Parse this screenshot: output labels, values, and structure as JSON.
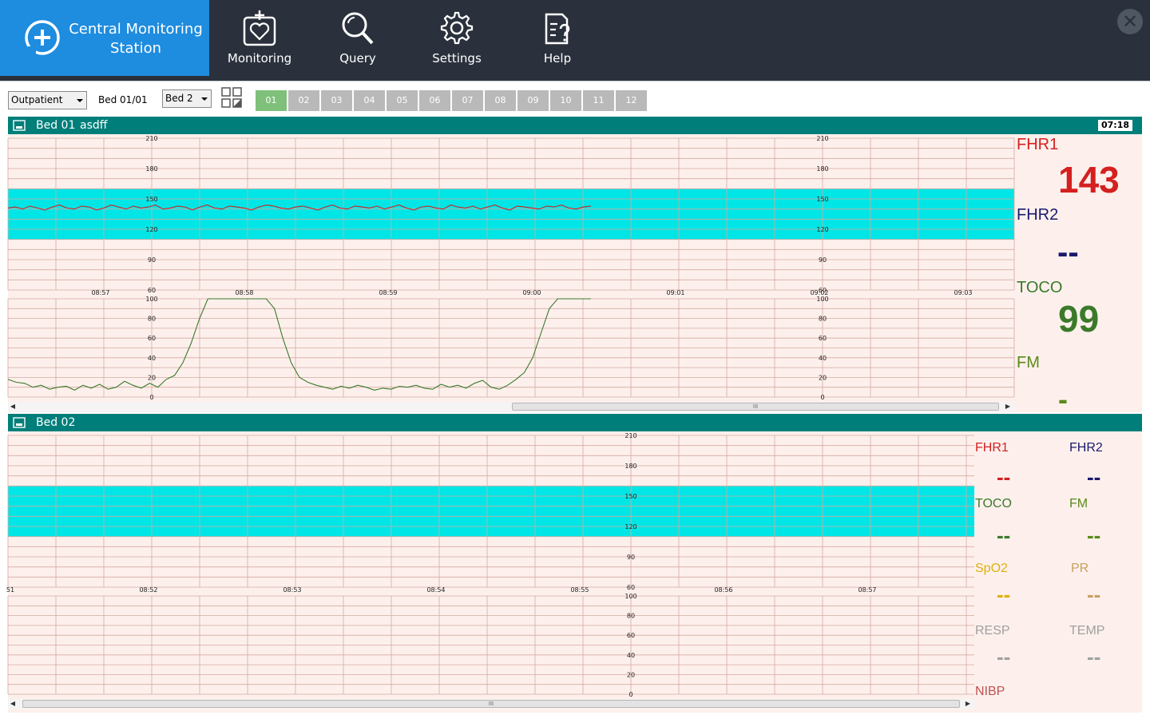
{
  "app": {
    "brand_title": "Central Monitoring Station",
    "nav": [
      {
        "label": "Monitoring",
        "icon": "heart-monitor-icon"
      },
      {
        "label": "Query",
        "icon": "search-icon"
      },
      {
        "label": "Settings",
        "icon": "gear-icon"
      },
      {
        "label": "Help",
        "icon": "help-document-icon"
      }
    ],
    "close_icon": "close-icon"
  },
  "toolbar": {
    "patient_type": "Outpatient",
    "bed_label": "Bed 01/01",
    "bed_select": "Bed 2",
    "layout_icon": "grid-layout-icon",
    "bed_tabs": [
      "01",
      "02",
      "03",
      "04",
      "05",
      "06",
      "07",
      "08",
      "09",
      "10",
      "11",
      "12"
    ],
    "active_tab": "01"
  },
  "colors": {
    "header_bg": "#2a313c",
    "brand_bg": "#1e8cdf",
    "bed_header": "#007f7a",
    "chart_bg": "#fdf0ec",
    "normal_band": "#00e6e6",
    "fhr1": "#d42020",
    "fhr2": "#1a1a6e",
    "toco": "#3a7a2a",
    "fm": "#5a8a1a",
    "spo2": "#e0b010",
    "pr": "#c8a060",
    "resp": "#a0a0a0",
    "nibp": "#c05050"
  },
  "bed1": {
    "name": "Bed 01",
    "patient": "asdff",
    "clock": "07:18",
    "fhr_axis": [
      "210",
      "180",
      "150",
      "120",
      "90",
      "60"
    ],
    "toco_axis": [
      "100",
      "80",
      "60",
      "40",
      "20",
      "0"
    ],
    "time_labels": [
      "08:57",
      "08:58",
      "08:59",
      "09:00",
      "09:01",
      "09:02",
      "09:03"
    ],
    "params": {
      "fhr1_label": "FHR1",
      "fhr1_value": "143",
      "fhr2_label": "FHR2",
      "fhr2_value": "--",
      "toco_label": "TOCO",
      "toco_value": "99",
      "fm_label": "FM",
      "fm_value": "-"
    },
    "scroll_grip": "III"
  },
  "bed2": {
    "name": "Bed 02",
    "fhr_axis": [
      "210",
      "180",
      "150",
      "120",
      "90",
      "60"
    ],
    "toco_axis": [
      "100",
      "80",
      "60",
      "40",
      "20",
      "0"
    ],
    "time_labels": [
      "51",
      "08:52",
      "08:53",
      "08:54",
      "08:55",
      "08:56",
      "08:57"
    ],
    "params": {
      "fhr1_label": "FHR1",
      "fhr1_value": "--",
      "fhr2_label": "FHR2",
      "fhr2_value": "--",
      "toco_label": "TOCO",
      "toco_value": "--",
      "fm_label": "FM",
      "fm_value": "--",
      "spo2_label": "SpO2",
      "spo2_value": "--",
      "pr_label": "PR",
      "pr_value": "--",
      "resp_label": "RESP",
      "resp_value": "--",
      "temp_label": "TEMP",
      "temp_value": "--",
      "nibp_label": "NIBP"
    },
    "scroll_grip": "III"
  },
  "chart_data": [
    {
      "type": "line",
      "title": "Bed 01 FHR1",
      "x": [
        "08:57",
        "08:58",
        "08:59",
        "09:00",
        "09:01",
        "09:02",
        "09:03"
      ],
      "ylim": [
        60,
        210
      ],
      "normal_band": [
        110,
        160
      ],
      "series": [
        {
          "name": "FHR1",
          "values": [
            141,
            142,
            140,
            143,
            141,
            139,
            142,
            144,
            141,
            140,
            143,
            142,
            139,
            141,
            144,
            142,
            140,
            143,
            141,
            142,
            144,
            140,
            141,
            143,
            142,
            139,
            142,
            144,
            141,
            140,
            143,
            142,
            141,
            139,
            142,
            144,
            143,
            141,
            140,
            142,
            143,
            141,
            139,
            142,
            144,
            141,
            140,
            143,
            142,
            141,
            143,
            140,
            142,
            144,
            141,
            139,
            142,
            143,
            141,
            140,
            144,
            142,
            141,
            143,
            140,
            142,
            144,
            141,
            139,
            143,
            142,
            141,
            140,
            143,
            142,
            144,
            141,
            140,
            142,
            143
          ]
        }
      ]
    },
    {
      "type": "line",
      "title": "Bed 01 TOCO",
      "x": [
        "08:57",
        "08:58",
        "08:59",
        "09:00",
        "09:01",
        "09:02",
        "09:03"
      ],
      "ylim": [
        0,
        100
      ],
      "series": [
        {
          "name": "TOCO",
          "values": [
            18,
            15,
            14,
            10,
            12,
            8,
            10,
            11,
            7,
            12,
            9,
            13,
            8,
            10,
            16,
            12,
            9,
            14,
            10,
            18,
            22,
            35,
            55,
            80,
            100,
            100,
            100,
            100,
            100,
            100,
            100,
            100,
            90,
            60,
            35,
            20,
            15,
            12,
            10,
            8,
            11,
            9,
            12,
            10,
            7,
            9,
            8,
            11,
            10,
            12,
            9,
            8,
            13,
            10,
            12,
            9,
            14,
            17,
            10,
            8,
            12,
            18,
            25,
            40,
            65,
            90,
            100,
            100,
            100,
            100,
            100
          ]
        }
      ]
    }
  ]
}
